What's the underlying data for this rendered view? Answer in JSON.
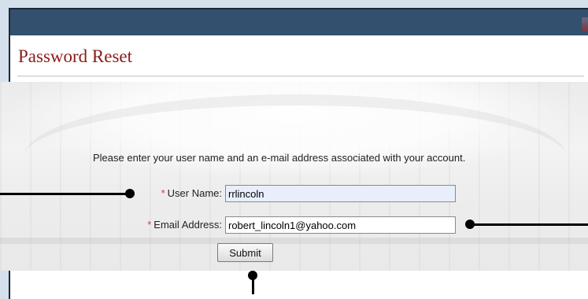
{
  "page": {
    "title": "Password Reset",
    "instructions": "Please enter your user name and an e-mail address associated with your account."
  },
  "form": {
    "required_marker": "*",
    "username": {
      "label": "User Name:",
      "value": "rrlincoln"
    },
    "email": {
      "label": "Email Address:",
      "value": "robert_lincoln1@yahoo.com"
    },
    "submit_label": "Submit"
  },
  "colors": {
    "header_bar": "#33506e",
    "title": "#8b1a1a",
    "required_marker": "#d23a3a",
    "autofill_field": "#e8eefb",
    "callout": "#000000"
  }
}
